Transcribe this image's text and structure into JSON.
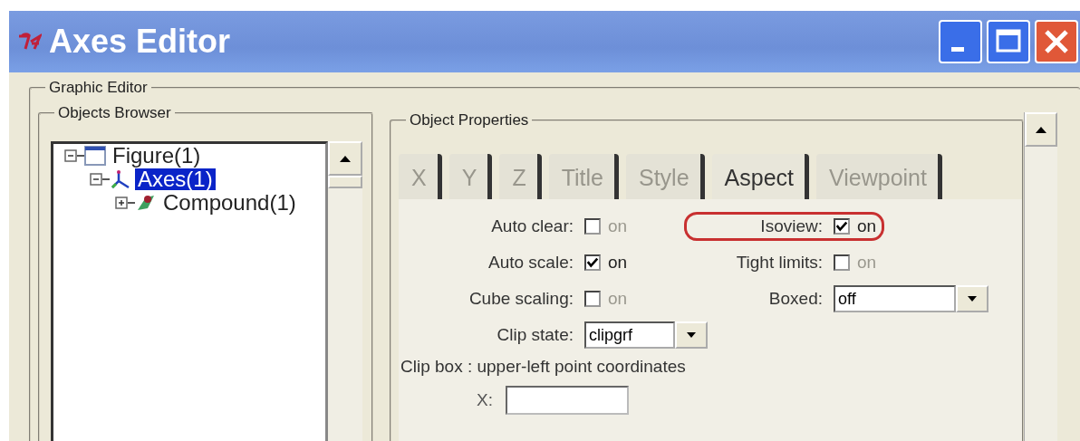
{
  "window": {
    "title": "Axes Editor"
  },
  "graphic_editor": {
    "title": "Graphic Editor"
  },
  "objects_browser": {
    "title": "Objects Browser",
    "tree": [
      {
        "label": "Figure(1)",
        "kind": "figure",
        "expanded": true,
        "selected": false,
        "children": [
          {
            "label": "Axes(1)",
            "kind": "axes",
            "expanded": true,
            "selected": true,
            "children": [
              {
                "label": "Compound(1)",
                "kind": "compound",
                "expanded": false,
                "selected": false
              }
            ]
          }
        ]
      }
    ]
  },
  "object_properties": {
    "title": "Object Properties",
    "tabs": [
      {
        "label": "X",
        "selected": false
      },
      {
        "label": "Y",
        "selected": false
      },
      {
        "label": "Z",
        "selected": false
      },
      {
        "label": "Title",
        "selected": false
      },
      {
        "label": "Style",
        "selected": false
      },
      {
        "label": "Aspect",
        "selected": true
      },
      {
        "label": "Viewpoint",
        "selected": false
      }
    ],
    "rows": [
      [
        {
          "kind": "checkbox",
          "label": "Auto clear:",
          "checked": false,
          "text": "on"
        },
        {
          "kind": "checkbox",
          "label": "Isoview:",
          "checked": true,
          "text": "on",
          "highlighted": true
        }
      ],
      [
        {
          "kind": "checkbox",
          "label": "Auto scale:",
          "checked": true,
          "text": "on"
        },
        {
          "kind": "checkbox",
          "label": "Tight limits:",
          "checked": false,
          "text": "on"
        }
      ],
      [
        {
          "kind": "checkbox",
          "label": "Cube scaling:",
          "checked": false,
          "text": "on"
        },
        {
          "kind": "dropdown",
          "label": "Boxed:",
          "value": "off"
        }
      ],
      [
        {
          "kind": "dropdown",
          "label": "Clip state:",
          "value": "clipgrf"
        }
      ]
    ],
    "clip_box": {
      "caption": "Clip box : upper-left point coordinates",
      "fields": [
        {
          "label": "X:"
        }
      ]
    }
  }
}
